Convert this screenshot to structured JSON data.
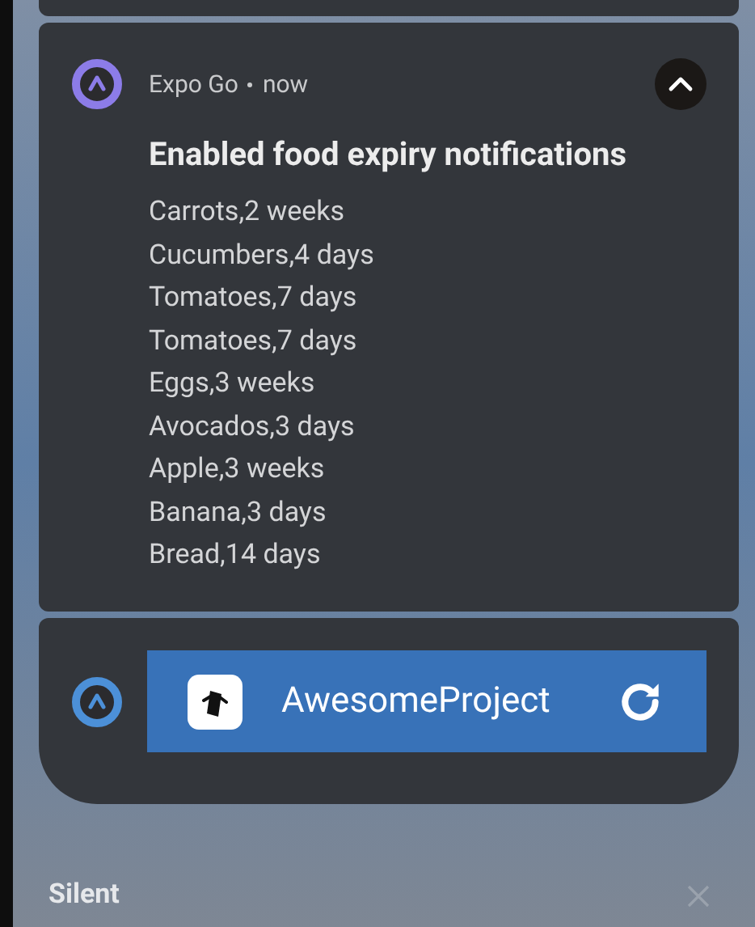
{
  "notification": {
    "app_name": "Expo Go",
    "time": "now",
    "expanded": true,
    "title": "Enabled food expiry notifications",
    "lines": [
      "Carrots,2 weeks",
      "Cucumbers,4 days",
      "Tomatoes,7 days",
      "Tomatoes,7 days",
      "Eggs,3 weeks",
      "Avocados,3 days",
      "Apple,3 weeks",
      "Banana,3 days",
      "Bread,14 days"
    ]
  },
  "media_card": {
    "project_name": "AwesomeProject"
  },
  "section": {
    "label": "Silent"
  }
}
